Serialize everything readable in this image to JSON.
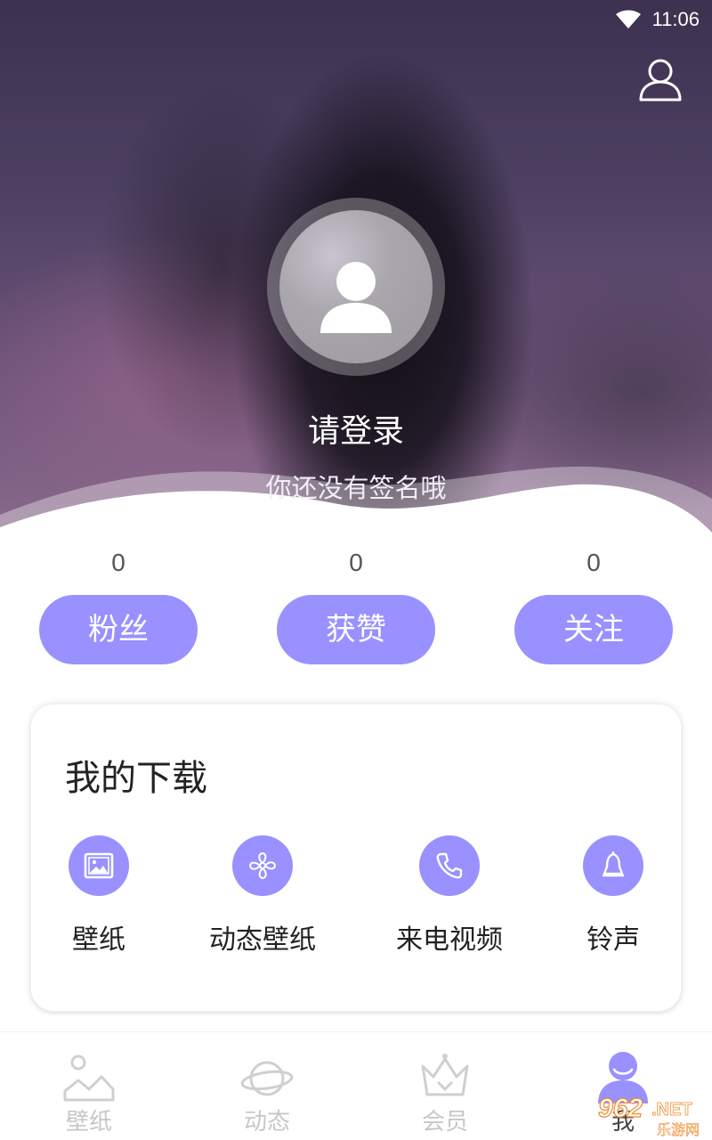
{
  "status_bar": {
    "time": "11:06",
    "wifi_icon": "wifi-icon"
  },
  "header": {
    "profile_icon": "user-outline-icon",
    "avatar_icon": "default-avatar-icon",
    "login_prompt": "请登录",
    "signature": "你还没有签名哦"
  },
  "stats": [
    {
      "count": "0",
      "label": "粉丝"
    },
    {
      "count": "0",
      "label": "获赞"
    },
    {
      "count": "0",
      "label": "关注"
    }
  ],
  "downloads": {
    "title": "我的下载",
    "items": [
      {
        "label": "壁纸",
        "icon": "image-icon"
      },
      {
        "label": "动态壁纸",
        "icon": "fan-icon"
      },
      {
        "label": "来电视频",
        "icon": "phone-icon"
      },
      {
        "label": "铃声",
        "icon": "bell-icon"
      }
    ]
  },
  "bottom_nav": [
    {
      "label": "壁纸",
      "icon": "mountain-icon",
      "active": false
    },
    {
      "label": "动态",
      "icon": "planet-icon",
      "active": false
    },
    {
      "label": "会员",
      "icon": "crown-icon",
      "active": false
    },
    {
      "label": "我",
      "icon": "user-filled-icon",
      "active": true
    }
  ],
  "watermark": {
    "text": "962.NET",
    "subtext": "乐游网"
  },
  "colors": {
    "accent": "#9891ff",
    "nav_inactive": "#c7c7c7",
    "text_dark": "#222222"
  }
}
